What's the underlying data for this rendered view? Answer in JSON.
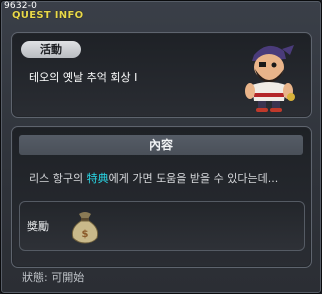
{
  "window": {
    "quest_id": "9632-0",
    "title": "QUEST INFO"
  },
  "activity": {
    "label": "活動",
    "quest_name": "테오의 옛날 추억 회상 I"
  },
  "content": {
    "header": "內容",
    "description_before": "리스 항구의 ",
    "description_highlight": "特典",
    "description_after": "에게 가면 도움을 받을 수 있다는데...",
    "highlight_color": "#29d9e8"
  },
  "reward": {
    "label": "獎勵",
    "item_icon": "money-bag-icon"
  },
  "status": {
    "text": "狀態:  可開始"
  }
}
